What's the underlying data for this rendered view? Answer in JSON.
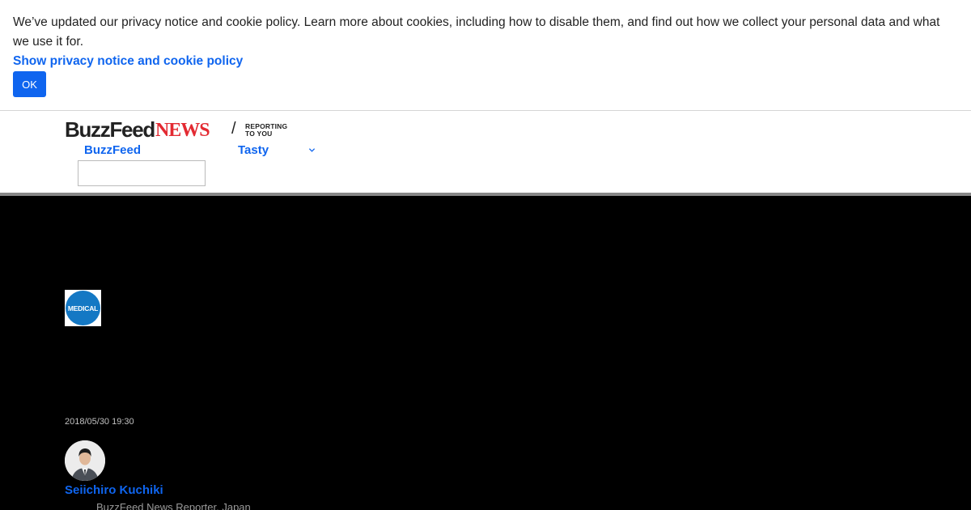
{
  "cookie_banner": {
    "message": "We’ve updated our privacy notice and cookie policy. Learn more about cookies, including how to disable them, and find out how we collect your personal data and what we use it for.",
    "link_label": "Show privacy notice and cookie policy",
    "ok_label": "OK"
  },
  "header": {
    "logo_buzz": "BuzzFeed",
    "logo_news": "NEWS",
    "separator": "/",
    "tagline_line1": "REPORTING",
    "tagline_line2": "TO YOU",
    "nav": [
      {
        "label": "BuzzFeed"
      },
      {
        "label": "Tasty"
      }
    ],
    "search_value": ""
  },
  "article": {
    "category_badge": "MEDICAL",
    "timestamp": "2018/05/30 19:30",
    "author": {
      "name": "Seiichiro Kuchiki",
      "role": "BuzzFeed News Reporter, Japan"
    }
  },
  "colors": {
    "accent": "#0f65ef",
    "news_red": "#e32a32",
    "badge_blue": "#1478c4",
    "hero_bg": "#000000"
  }
}
